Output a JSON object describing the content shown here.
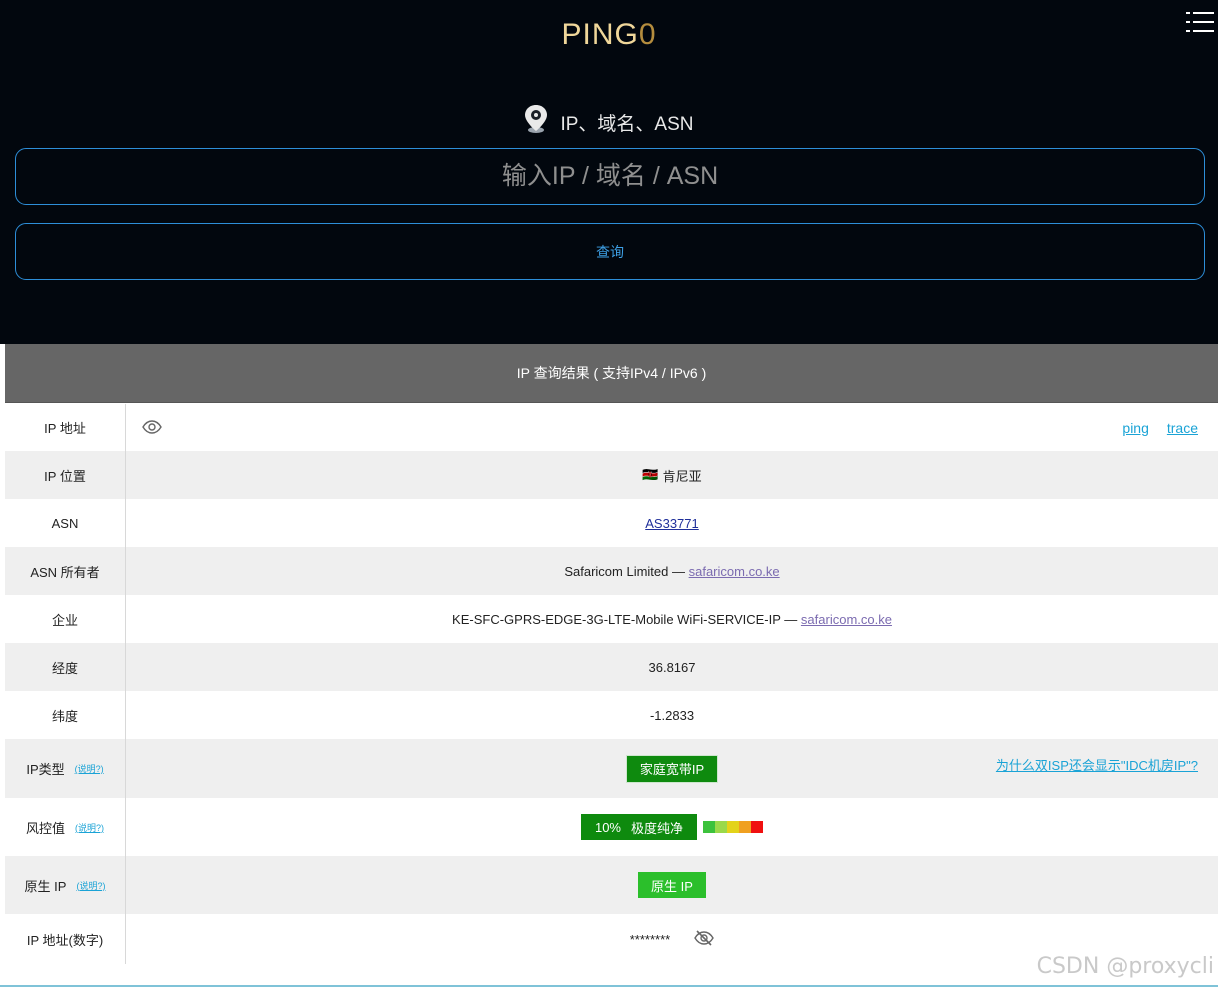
{
  "header": {
    "logo_main": "PING",
    "logo_zero": "0",
    "menu_icon": "hamburger-list-icon",
    "hint_icon": "map-pin-icon",
    "hint_text": "IP、域名、ASN",
    "search_placeholder": "输入IP / 域名 / ASN",
    "search_value": "",
    "query_button": "查询"
  },
  "results": {
    "title": "IP 查询结果 ( 支持IPv4 / IPv6 )",
    "ip_address": {
      "label": "IP 地址",
      "eye_icon": "eye-icon",
      "ping_link": "ping",
      "trace_link": "trace"
    },
    "ip_location": {
      "label": "IP 位置",
      "flag": "🇰🇪",
      "value": "肯尼亚"
    },
    "asn": {
      "label": "ASN",
      "value": "AS33771"
    },
    "asn_owner": {
      "label": "ASN 所有者",
      "value": "Safaricom Limited — ",
      "link": "safaricom.co.ke"
    },
    "enterprise": {
      "label": "企业",
      "value": "KE-SFC-GPRS-EDGE-3G-LTE-Mobile WiFi-SERVICE-IP — ",
      "link": "safaricom.co.ke"
    },
    "longitude": {
      "label": "经度",
      "value": "36.8167"
    },
    "latitude": {
      "label": "纬度",
      "value": "-1.2833"
    },
    "ip_type": {
      "label": "IP类型",
      "help": "(说明?)",
      "badge": "家庭宽带IP",
      "why_link": "为什么双ISP还会显示\"IDC机房IP\"?"
    },
    "risk": {
      "label": "风控值",
      "help": "(说明?)",
      "percent": "10%",
      "text": "极度纯净",
      "bar_colors": [
        "#3cc23c",
        "#9ad94a",
        "#e3d31a",
        "#f0a020",
        "#f01010"
      ]
    },
    "native_ip": {
      "label": "原生 IP",
      "help": "(说明?)",
      "badge": "原生 IP"
    },
    "ip_numeric": {
      "label": "IP 地址(数字)",
      "value": "********",
      "eye_icon": "eye-slash-icon"
    }
  },
  "watermark": "CSDN @proxycli"
}
